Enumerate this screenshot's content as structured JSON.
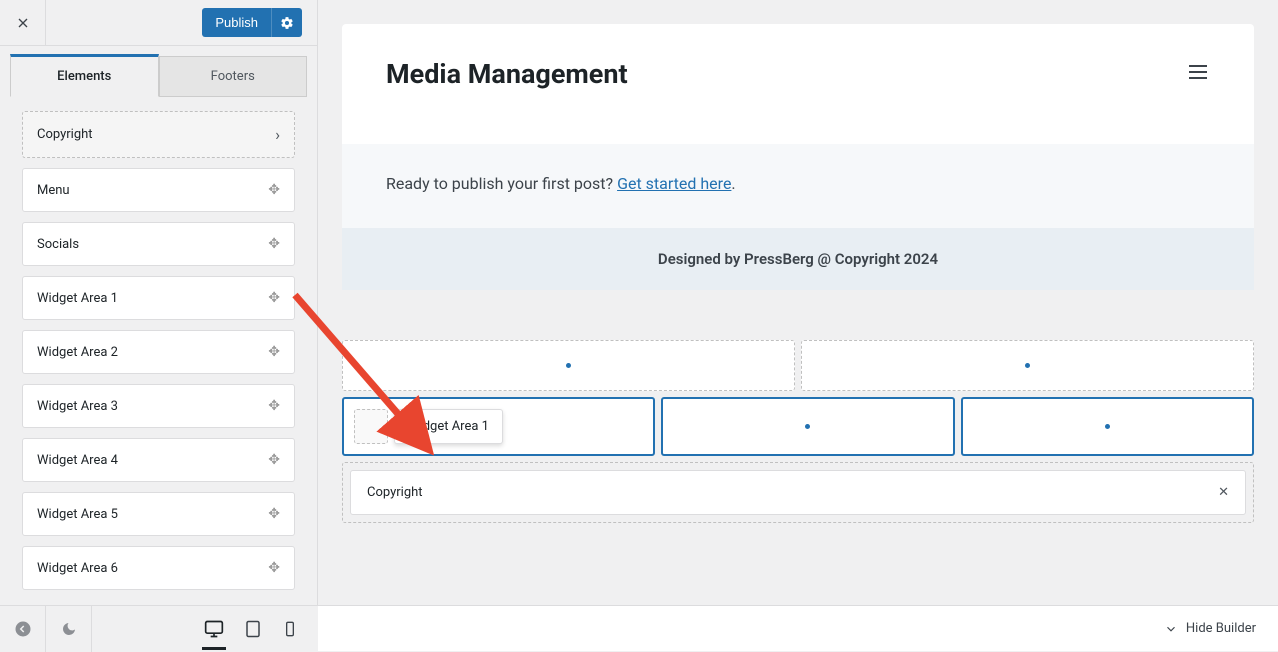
{
  "sidebar": {
    "publish_label": "Publish",
    "tabs": {
      "elements": "Elements",
      "footers": "Footers"
    },
    "items": [
      {
        "label": "Copyright",
        "type": "nav"
      },
      {
        "label": "Menu",
        "type": "move"
      },
      {
        "label": "Socials",
        "type": "move"
      },
      {
        "label": "Widget Area 1",
        "type": "move"
      },
      {
        "label": "Widget Area 2",
        "type": "move"
      },
      {
        "label": "Widget Area 3",
        "type": "move"
      },
      {
        "label": "Widget Area 4",
        "type": "move"
      },
      {
        "label": "Widget Area 5",
        "type": "move"
      },
      {
        "label": "Widget Area 6",
        "type": "move"
      }
    ]
  },
  "preview": {
    "title": "Media Management",
    "content_prefix": "Ready to publish your first post? ",
    "content_link": "Get started here",
    "content_suffix": ".",
    "footer": "Designed by PressBerg @ Copyright 2024"
  },
  "builder": {
    "dragged_widget": "Widget Area 1",
    "copyright_label": "Copyright"
  },
  "bottom": {
    "hide_builder": "Hide Builder"
  }
}
